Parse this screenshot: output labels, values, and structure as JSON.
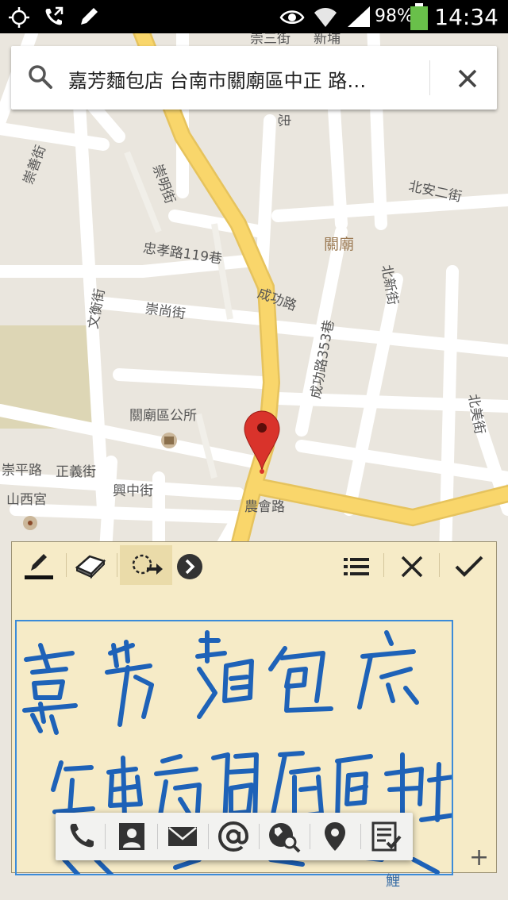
{
  "status_bar": {
    "battery": "98%",
    "time": "14:34",
    "icons": [
      "gps-icon",
      "call-forward-icon",
      "pen-icon",
      "eye-icon",
      "wifi-icon",
      "signal-icon",
      "battery-icon"
    ]
  },
  "search": {
    "query": "嘉芳麵包店 台南市關廟區中正 路…"
  },
  "map": {
    "labels": {
      "chongshan_st": "崇善街",
      "chongming_st": "崇明街",
      "zhongxiao_119": "忠孝路119巷",
      "wenheng_st": "文衡街",
      "chongshang_st": "崇尚街",
      "chenggong_rd": "成功路",
      "chenggong_353": "成功路353巷",
      "beian_2nd": "北安二街",
      "guanmiao": "關廟",
      "beixin_st": "北新街",
      "district_office": "關廟區公所",
      "beimei_st": "北美街",
      "chongping_rd": "崇平路",
      "zhengyi_st": "正義街",
      "shanxi_temple": "山西宮",
      "xingzhong_st": "興中街",
      "nonghui_rd": "農會路",
      "top_frag_1": "崇三街",
      "top_frag_2": "新埔",
      "top_frag_3": "忠",
      "bottom_frag": "鯉"
    },
    "colors": {
      "background": "#eae6de",
      "road": "#ffffff",
      "main_road": "#f9d66b",
      "pin": "#d9332b"
    }
  },
  "notepad": {
    "toolbar": [
      "pen-tool-icon",
      "eraser-icon",
      "lasso-select-icon",
      "expand-arrow-icon",
      "list-icon",
      "close-icon",
      "check-icon"
    ],
    "handwriting_line_1": "嘉芳麵包店",
    "handwriting_line_2": "台南市關廟區中正",
    "plus": "+"
  },
  "action_bar": [
    "phone-icon",
    "contact-icon",
    "email-icon",
    "at-icon",
    "web-search-icon",
    "location-icon",
    "task-icon"
  ]
}
